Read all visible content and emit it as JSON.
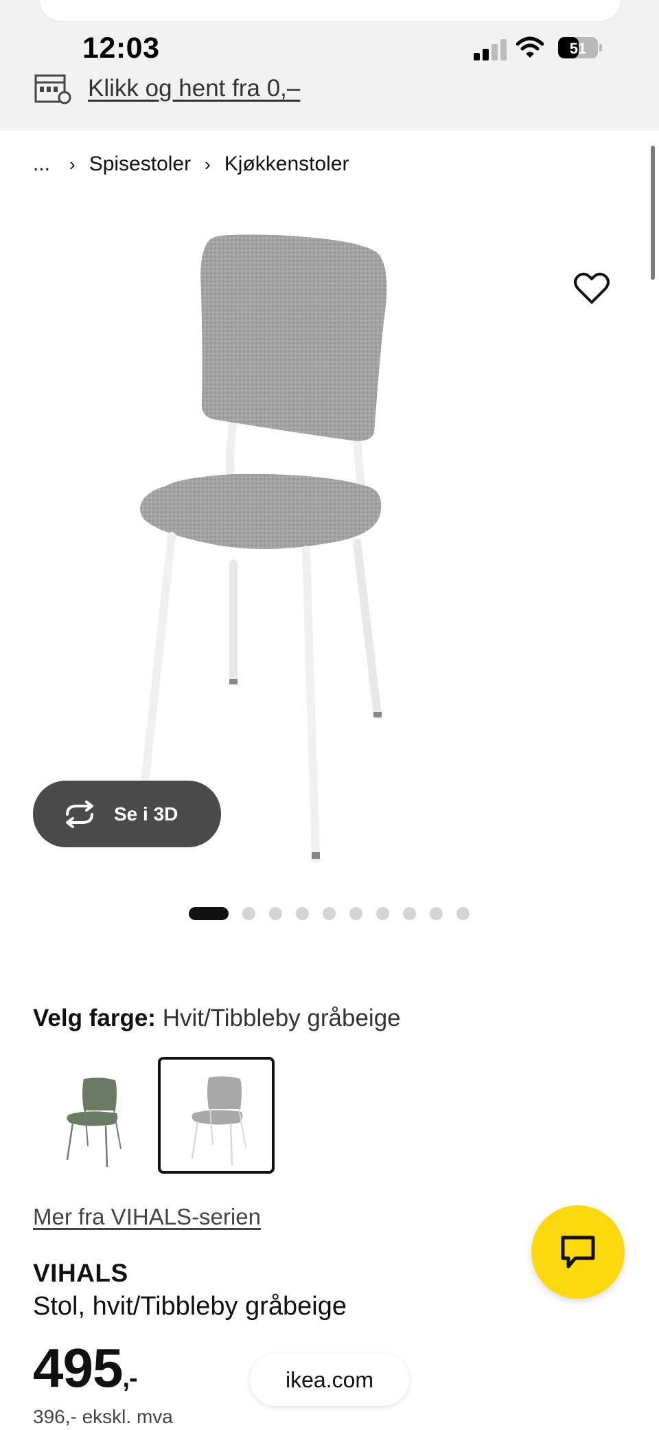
{
  "status_bar": {
    "time": "12:03",
    "battery": "51"
  },
  "store": {
    "link_text": "Klikk og hent fra 0,–",
    "icon": "store-icon"
  },
  "breadcrumb": {
    "ellipsis": "...",
    "items": [
      "Spisestoler",
      "Kjøkkenstoler"
    ]
  },
  "gallery": {
    "view_3d_label": "Se i 3D",
    "image_count": 10,
    "active_index": 0
  },
  "color": {
    "label": "Velg farge:",
    "selected": "Hvit/Tibbleby gråbeige",
    "swatches": [
      "green",
      "grey"
    ]
  },
  "product": {
    "series_link": "Mer fra VIHALS-serien",
    "name": "VIHALS",
    "description": "Stol, hvit/Tibbleby gråbeige",
    "price": "495",
    "price_suffix": ",-",
    "price_excl_vat": "396,- ekskl. mva"
  },
  "browser": {
    "domain": "ikea.com"
  },
  "colors": {
    "chat_button": "#fcd90e",
    "button_3d": "#4a4a4a"
  }
}
